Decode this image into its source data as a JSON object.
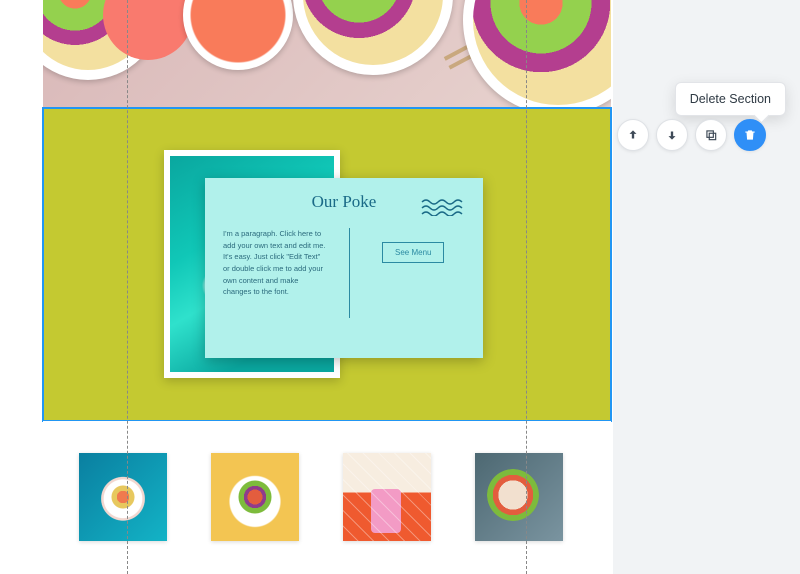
{
  "tooltip": {
    "label": "Delete Section"
  },
  "toolbar": {
    "move_up": "Move Up",
    "move_down": "Move Down",
    "duplicate": "Duplicate",
    "delete": "Delete"
  },
  "postcard": {
    "title": "Our Poke",
    "paragraph": "I'm a paragraph. Click here to add your own text and edit me. It's easy. Just click \"Edit Text\" or double click me to add your own content and make changes to the font.",
    "button_label": "See Menu"
  },
  "gallery": {
    "items": [
      {
        "alt": "poke-bowl-teal-table"
      },
      {
        "alt": "poke-bowl-yellow-bg"
      },
      {
        "alt": "pink-drink-striped"
      },
      {
        "alt": "poke-bowl-denim"
      }
    ]
  },
  "colors": {
    "selection": "#2196f3",
    "section_bg": "#c4c931",
    "postcard_bg": "#b1f1eb",
    "accent_blue": "#2f8ff7"
  }
}
